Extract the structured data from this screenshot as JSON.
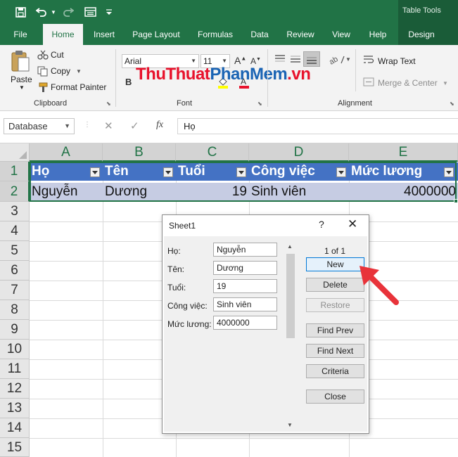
{
  "quick_access": {
    "save_icon": "save-icon",
    "undo_icon": "undo-icon",
    "redo_icon": "redo-icon",
    "form_icon": "form-icon",
    "customize_icon": "chevron-down-icon"
  },
  "contextual_title": "Table Tools",
  "tabs": [
    {
      "label": "File"
    },
    {
      "label": "Home",
      "active": true
    },
    {
      "label": "Insert"
    },
    {
      "label": "Page Layout"
    },
    {
      "label": "Formulas"
    },
    {
      "label": "Data"
    },
    {
      "label": "Review"
    },
    {
      "label": "View"
    },
    {
      "label": "Help"
    },
    {
      "label": "Design"
    }
  ],
  "ribbon": {
    "clipboard": {
      "paste": "Paste",
      "cut": "Cut",
      "copy": "Copy",
      "format_painter": "Format Painter",
      "group_label": "Clipboard"
    },
    "font": {
      "font_name": "Arial",
      "font_size": "11",
      "bold": "B",
      "grow": "A",
      "shrink": "A",
      "group_label": "Font"
    },
    "alignment": {
      "wrap_text": "Wrap Text",
      "merge_center": "Merge & Center",
      "group_label": "Alignment"
    },
    "watermark": {
      "part1": "ThuThuat",
      "part2": "PhanMem",
      "part3": ".vn"
    }
  },
  "formula_bar": {
    "name_box": "Database",
    "fx": "fx",
    "formula": "Họ"
  },
  "sheet": {
    "columns": [
      "A",
      "B",
      "C",
      "D",
      "E"
    ],
    "rows": [
      "1",
      "2",
      "3",
      "4",
      "5",
      "6",
      "7",
      "8",
      "9",
      "10",
      "11",
      "12",
      "13",
      "14",
      "15"
    ],
    "headers": [
      "Họ",
      "Tên",
      "Tuổi",
      "Công việc",
      "Mức lương"
    ],
    "record": [
      "Nguyễn",
      "Dương",
      "19",
      "Sinh viên",
      "4000000"
    ]
  },
  "dialog": {
    "title": "Sheet1",
    "help": "?",
    "close": "✕",
    "record_count": "1 of 1",
    "fields": [
      {
        "label": "Họ:",
        "value": "Nguyễn"
      },
      {
        "label": "Tên:",
        "value": "Dương"
      },
      {
        "label": "Tuổi:",
        "value": "19"
      },
      {
        "label": "Công việc:",
        "value": "Sinh viên"
      },
      {
        "label": "Mức lương:",
        "value": "4000000"
      }
    ],
    "buttons": {
      "new": "New",
      "delete": "Delete",
      "restore": "Restore",
      "find_prev": "Find Prev",
      "find_next": "Find Next",
      "criteria": "Criteria",
      "close": "Close"
    }
  },
  "colors": {
    "excel_green": "#217346",
    "table_header": "#4472c4",
    "table_row": "#c6cce3",
    "arrow": "#e8333a"
  }
}
